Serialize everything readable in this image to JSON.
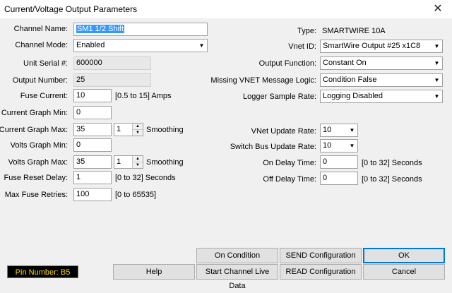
{
  "window": {
    "title": "Current/Voltage Output Parameters",
    "close_glyph": "✕"
  },
  "left": {
    "channel_name": {
      "label": "Channel Name:",
      "value": "SM1 1/2 Shift"
    },
    "channel_mode": {
      "label": "Channel Mode:",
      "value": "Enabled"
    },
    "unit_serial": {
      "label": "Unit Serial #:",
      "value": "600000"
    },
    "output_number": {
      "label": "Output Number:",
      "value": "25"
    },
    "fuse_current": {
      "label": "Fuse Current:",
      "value": "10",
      "hint": "[0.5 to 15] Amps"
    },
    "current_graph_min": {
      "label": "Current Graph Min:",
      "value": "0"
    },
    "current_graph_max": {
      "label": "Current Graph Max:",
      "value": "35",
      "smoothing_value": "1",
      "smoothing_label": "Smoothing"
    },
    "volts_graph_min": {
      "label": "Volts Graph Min:",
      "value": "0"
    },
    "volts_graph_max": {
      "label": "Volts Graph Max:",
      "value": "35",
      "smoothing_value": "1",
      "smoothing_label": "Smoothing"
    },
    "fuse_reset_delay": {
      "label": "Fuse Reset Delay:",
      "value": "1",
      "hint": "[0 to 32] Seconds"
    },
    "max_fuse_retries": {
      "label": "Max Fuse Retries:",
      "value": "100",
      "hint": "[0 to 65535]"
    }
  },
  "right": {
    "type": {
      "label": "Type:",
      "value": "SMARTWIRE 10A"
    },
    "vnet_id": {
      "label": "Vnet ID:",
      "value": "SmartWire Output #25  x1C8"
    },
    "output_function": {
      "label": "Output Function:",
      "value": "Constant On"
    },
    "missing_vnet": {
      "label": "Missing VNET Message Logic:",
      "value": "Condition False"
    },
    "logger_rate": {
      "label": "Logger Sample Rate:",
      "value": "Logging Disabled"
    },
    "vnet_update_rate": {
      "label": "VNet Update Rate:",
      "value": "10"
    },
    "switch_bus_rate": {
      "label": "Switch Bus Update Rate:",
      "value": "10"
    },
    "on_delay": {
      "label": "On Delay Time:",
      "value": "0",
      "hint": "[0 to 32] Seconds"
    },
    "off_delay": {
      "label": "Off Delay Time:",
      "value": "0",
      "hint": "[0 to 32] Seconds"
    }
  },
  "buttons": {
    "on_condition": "On Condition",
    "send_config": "SEND Configuration",
    "ok": "OK",
    "help": "Help",
    "live_data": "Start Channel Live Data",
    "read_config": "READ Configuration",
    "cancel": "Cancel"
  },
  "pin_number": "Pin Number: B5",
  "icons": {
    "dropdown": "chevron-down-icon",
    "spin_up": "spin-up-icon",
    "spin_down": "spin-down-icon"
  },
  "colors": {
    "accent": "#0078d7",
    "selection": "#3399ff",
    "pin_bg": "#000000",
    "pin_fg": "#ffd700"
  }
}
